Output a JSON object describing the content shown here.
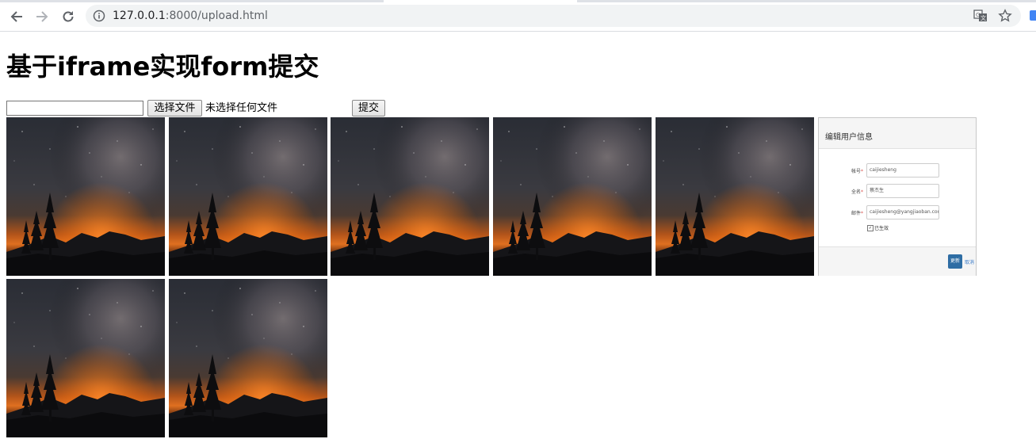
{
  "browser": {
    "url_host": "127.0.0.1",
    "url_rest": ":8000/upload.html",
    "icons": [
      "back-arrow-icon",
      "forward-arrow-icon",
      "reload-icon",
      "info-icon",
      "translate-icon",
      "star-icon",
      "extension-icon"
    ]
  },
  "page": {
    "title": "基于iframe实现form提交",
    "form": {
      "text_value": "",
      "file_button_label": "选择文件",
      "file_status": "未选择任何文件",
      "submit_label": "提交"
    },
    "images": [
      {
        "kind": "starry-night"
      },
      {
        "kind": "starry-night"
      },
      {
        "kind": "starry-night"
      },
      {
        "kind": "starry-night"
      },
      {
        "kind": "starry-night"
      },
      {
        "kind": "edit-user-dialog"
      },
      {
        "kind": "starry-night"
      },
      {
        "kind": "starry-night"
      }
    ],
    "dialog": {
      "title": "编辑用户信息",
      "account_label": "帐号",
      "account_value": "caijiesheng",
      "name_label": "全名",
      "name_value": "蔡杰生",
      "email_label": "邮件",
      "email_value": "caijiesheng@yangjiaoban.com",
      "active_label": "已生效",
      "update_label": "更新",
      "cancel_label": "取消"
    },
    "colors": {
      "sky_top": "#2a2d35",
      "horizon_glow": "#d9661a",
      "mountains": "#0d0d0f",
      "dialog_button": "#2e6da4"
    }
  }
}
